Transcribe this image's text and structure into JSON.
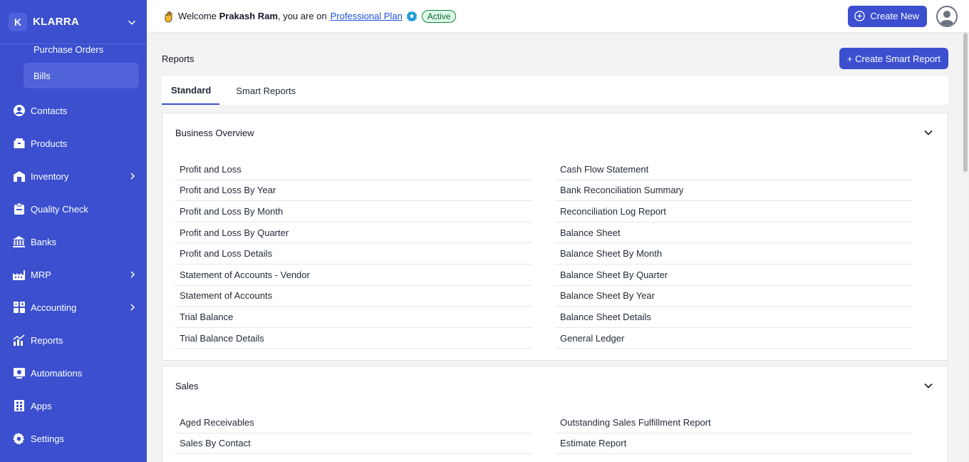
{
  "brand": {
    "badge": "K",
    "name": "KLARRA"
  },
  "sidebar": {
    "sub_items": [
      {
        "label": "Purchase Orders"
      },
      {
        "label": "Bills"
      }
    ],
    "items": [
      {
        "label": "Contacts",
        "icon": "contacts-icon"
      },
      {
        "label": "Products",
        "icon": "products-icon"
      },
      {
        "label": "Inventory",
        "icon": "inventory-icon"
      },
      {
        "label": "Quality Check",
        "icon": "quality-check-icon"
      },
      {
        "label": "Banks",
        "icon": "banks-icon"
      },
      {
        "label": "MRP",
        "icon": "mrp-icon"
      },
      {
        "label": "Accounting",
        "icon": "accounting-icon"
      },
      {
        "label": "Reports",
        "icon": "reports-icon"
      },
      {
        "label": "Automations",
        "icon": "automations-icon"
      },
      {
        "label": "Apps",
        "icon": "apps-icon"
      },
      {
        "label": "Settings",
        "icon": "settings-icon"
      }
    ]
  },
  "header": {
    "welcome_prefix": "Welcome",
    "user_name": "Prakash Ram",
    "welcome_suffix": ", you are on",
    "plan": "Professional Plan",
    "status": "Active",
    "create_new": "Create New"
  },
  "page": {
    "title": "Reports",
    "create_smart_report": "+ Create Smart Report",
    "tabs": [
      {
        "label": "Standard"
      },
      {
        "label": "Smart Reports"
      }
    ]
  },
  "sections": [
    {
      "title": "Business Overview",
      "left": [
        "Profit and Loss",
        "Profit and Loss By Year",
        "Profit and Loss By Month",
        "Profit and Loss By Quarter",
        "Profit and Loss Details",
        "Statement of Accounts - Vendor",
        "Statement of Accounts",
        "Trial Balance",
        "Trial Balance Details"
      ],
      "right": [
        "Cash Flow Statement",
        "Bank Reconciliation Summary",
        "Reconciliation Log Report",
        "Balance Sheet",
        "Balance Sheet By Month",
        "Balance Sheet By Quarter",
        "Balance Sheet By Year",
        "Balance Sheet Details",
        "General Ledger"
      ]
    },
    {
      "title": "Sales",
      "left": [
        "Aged Receivables",
        "Sales By Contact"
      ],
      "right": [
        "Outstanding Sales Fulfillment Report",
        "Estimate Report"
      ]
    }
  ],
  "colors": {
    "sidebar": "#3b4fcf",
    "accent": "#3b4fcf",
    "active_green": "#15803d"
  }
}
